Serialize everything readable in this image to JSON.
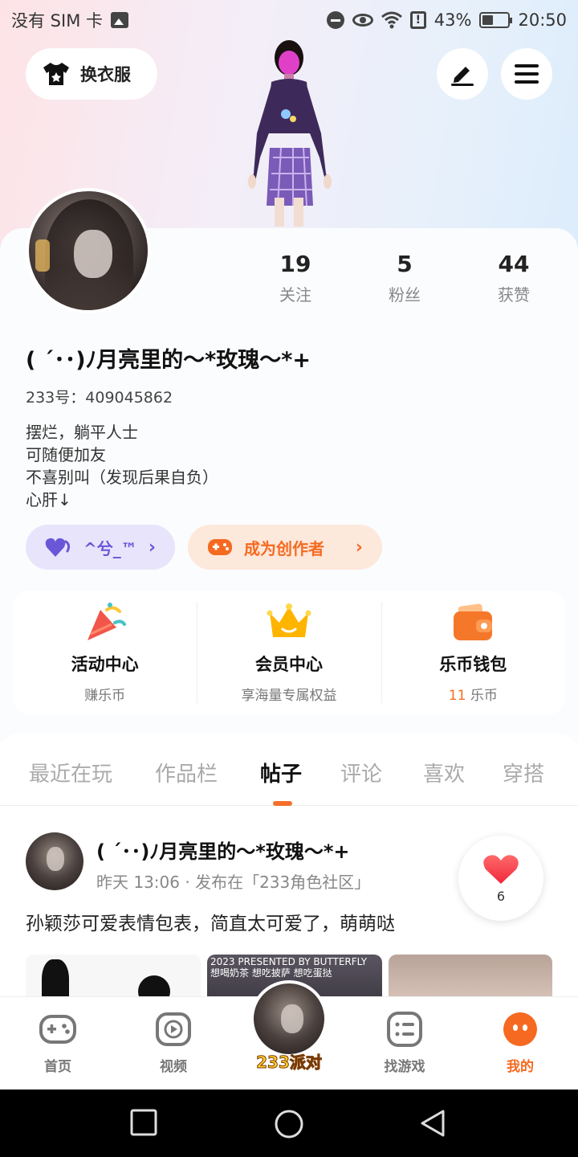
{
  "status_bar": {
    "carrier": "没有 SIM 卡",
    "battery_percent": "43%",
    "battery_level": 0.43,
    "time": "20:50",
    "icons": [
      "image-icon",
      "do-not-disturb-icon",
      "eye-icon",
      "wifi-icon",
      "alert-icon",
      "battery-icon"
    ]
  },
  "header": {
    "outfit_label": "换衣服",
    "edit_icon": "pen-icon",
    "menu_icon": "hamburger-menu-icon"
  },
  "profile": {
    "stats": [
      {
        "value": "19",
        "label": "关注"
      },
      {
        "value": "5",
        "label": "粉丝"
      },
      {
        "value": "44",
        "label": "获赞"
      }
    ],
    "nickname": "( ´･･)ﾉ月亮里的～*玫瑰～*+",
    "uid": "233号：409045862",
    "bio": [
      "摆烂，躺平人士",
      "可随便加友",
      "不喜别叫（发现后果自负）",
      "心肝↓"
    ],
    "tag_badge": "^兮_™",
    "creator_label": "成为创作者"
  },
  "entries": [
    {
      "title": "活动中心",
      "subtitle": "赚乐币",
      "icon": "party-popper-icon"
    },
    {
      "title": "会员中心",
      "subtitle": "享海量专属权益",
      "icon": "crown-icon"
    },
    {
      "title": "乐币钱包",
      "amount": "11",
      "subtitle": "乐币",
      "icon": "wallet-icon"
    }
  ],
  "tabs": [
    "最近在玩",
    "作品栏",
    "帖子",
    "评论",
    "喜欢",
    "穿搭"
  ],
  "active_tab": "帖子",
  "post": {
    "author": "( ´･･)ﾉ月亮里的～*玫瑰～*+",
    "meta": "昨天 13:06 · 发布在「233角色社区」",
    "text": "孙颖莎可爱表情包表，简直太可爱了，萌萌哒",
    "likes": "6",
    "thumb2_text": "2023 PRESENTED BY BUTTERFLY 想喝奶茶 想吃披萨 想吃蛋挞"
  },
  "bottom_nav": [
    {
      "label": "首页",
      "icon": "gamepad-icon"
    },
    {
      "label": "视频",
      "icon": "play-icon"
    },
    {
      "label": "233派对",
      "icon": "avatar"
    },
    {
      "label": "找游戏",
      "icon": "list-icon"
    },
    {
      "label": "我的",
      "icon": "profile-face-icon"
    }
  ],
  "colors": {
    "accent": "#f56a20",
    "purple": "#6a57d8",
    "tab_indicator": "#f5702a"
  }
}
